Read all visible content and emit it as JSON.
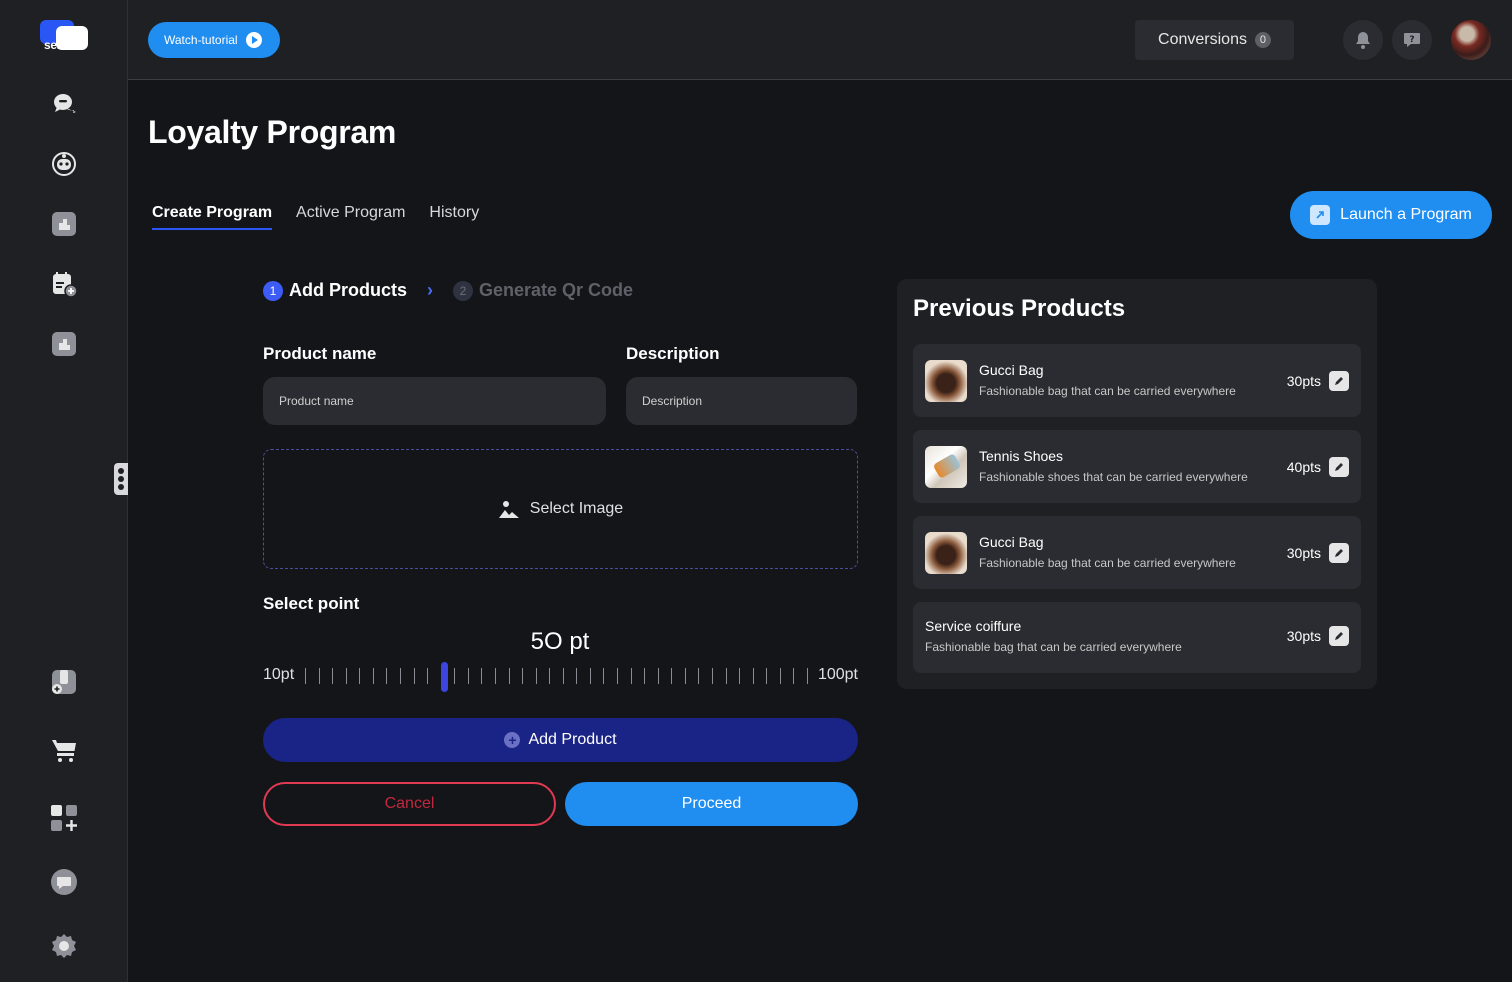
{
  "brand": {
    "logo_text": "sema"
  },
  "topbar": {
    "watch_label": "Watch-tutorial",
    "conversions_label": "Conversions",
    "conversions_count": "0"
  },
  "page": {
    "title": "Loyalty Program",
    "tabs": [
      {
        "label": "Create Program",
        "active": true
      },
      {
        "label": "Active Program",
        "active": false
      },
      {
        "label": "History",
        "active": false
      }
    ],
    "launch_label": "Launch a Program"
  },
  "steps": [
    {
      "num": "1",
      "label": "Add Products"
    },
    {
      "num": "2",
      "label": "Generate Qr Code"
    }
  ],
  "form": {
    "product_name_label": "Product name",
    "product_name_placeholder": "Product name",
    "description_label": "Description",
    "description_placeholder": "Description",
    "select_image_label": "Select Image",
    "select_point_label": "Select point",
    "point_value_text": "5O pt",
    "point_value": 50,
    "min_label": "10pt",
    "max_label": "100pt",
    "add_product_label": "Add Product",
    "cancel_label": "Cancel",
    "proceed_label": "Proceed"
  },
  "previous": {
    "title": "Previous Products",
    "items": [
      {
        "name": "Gucci Bag",
        "desc": "Fashionable bag that can be carried everywhere",
        "pts": "30pts",
        "thumb": "bag"
      },
      {
        "name": "Tennis Shoes",
        "desc": "Fashionable shoes that can be carried everywhere",
        "pts": "40pts",
        "thumb": "shoe"
      },
      {
        "name": "Gucci Bag",
        "desc": "Fashionable bag that can be carried everywhere",
        "pts": "30pts",
        "thumb": "bag"
      },
      {
        "name": "Service coiffure",
        "desc": "Fashionable bag that can be carried everywhere",
        "pts": "30pts",
        "thumb": ""
      }
    ]
  },
  "colors": {
    "accent": "#1f8ef0",
    "primary_dark": "#1a2386",
    "danger": "#e03a52",
    "background": "#131519",
    "surface": "#1e2024"
  },
  "sidebar_icons": [
    "chat-icon",
    "bot-icon",
    "dashboard-icon",
    "calendar-add-icon",
    "dashboard-icon",
    "store-add-icon",
    "cart-icon",
    "apps-add-icon",
    "message-icon",
    "settings-icon"
  ]
}
